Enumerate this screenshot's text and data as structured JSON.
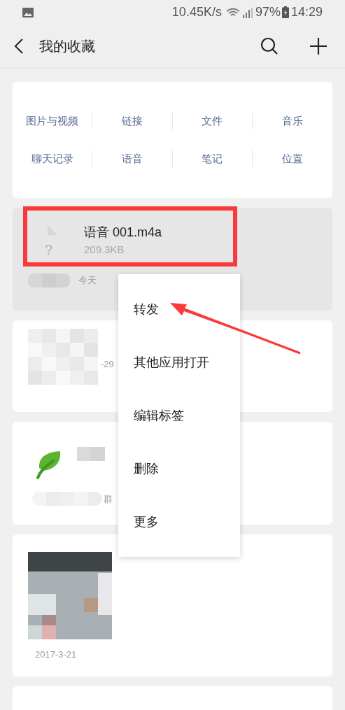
{
  "status_bar": {
    "speed": "10.45K/s",
    "battery": "97%",
    "time": "14:29"
  },
  "header": {
    "title": "我的收藏"
  },
  "categories": [
    {
      "label": "图片与视频"
    },
    {
      "label": "链接"
    },
    {
      "label": "文件"
    },
    {
      "label": "音乐"
    },
    {
      "label": "聊天记录"
    },
    {
      "label": "语音"
    },
    {
      "label": "笔记"
    },
    {
      "label": "位置"
    }
  ],
  "items": [
    {
      "kind": "file",
      "selected": true,
      "name": "语音 001.m4a",
      "size": "209.3KB",
      "file_icon_mark": "?",
      "date": "今天"
    },
    {
      "kind": "blurred",
      "selected": false,
      "date": "-29"
    },
    {
      "kind": "link",
      "selected": false,
      "date": "群"
    },
    {
      "selected": false,
      "date": "2017-3-21"
    },
    {
      "kind": "partial",
      "selected": false
    }
  ],
  "context_menu": [
    {
      "label": "转发"
    },
    {
      "label": "其他应用打开"
    },
    {
      "label": "编辑标签"
    },
    {
      "label": "删除"
    },
    {
      "label": "更多"
    }
  ]
}
